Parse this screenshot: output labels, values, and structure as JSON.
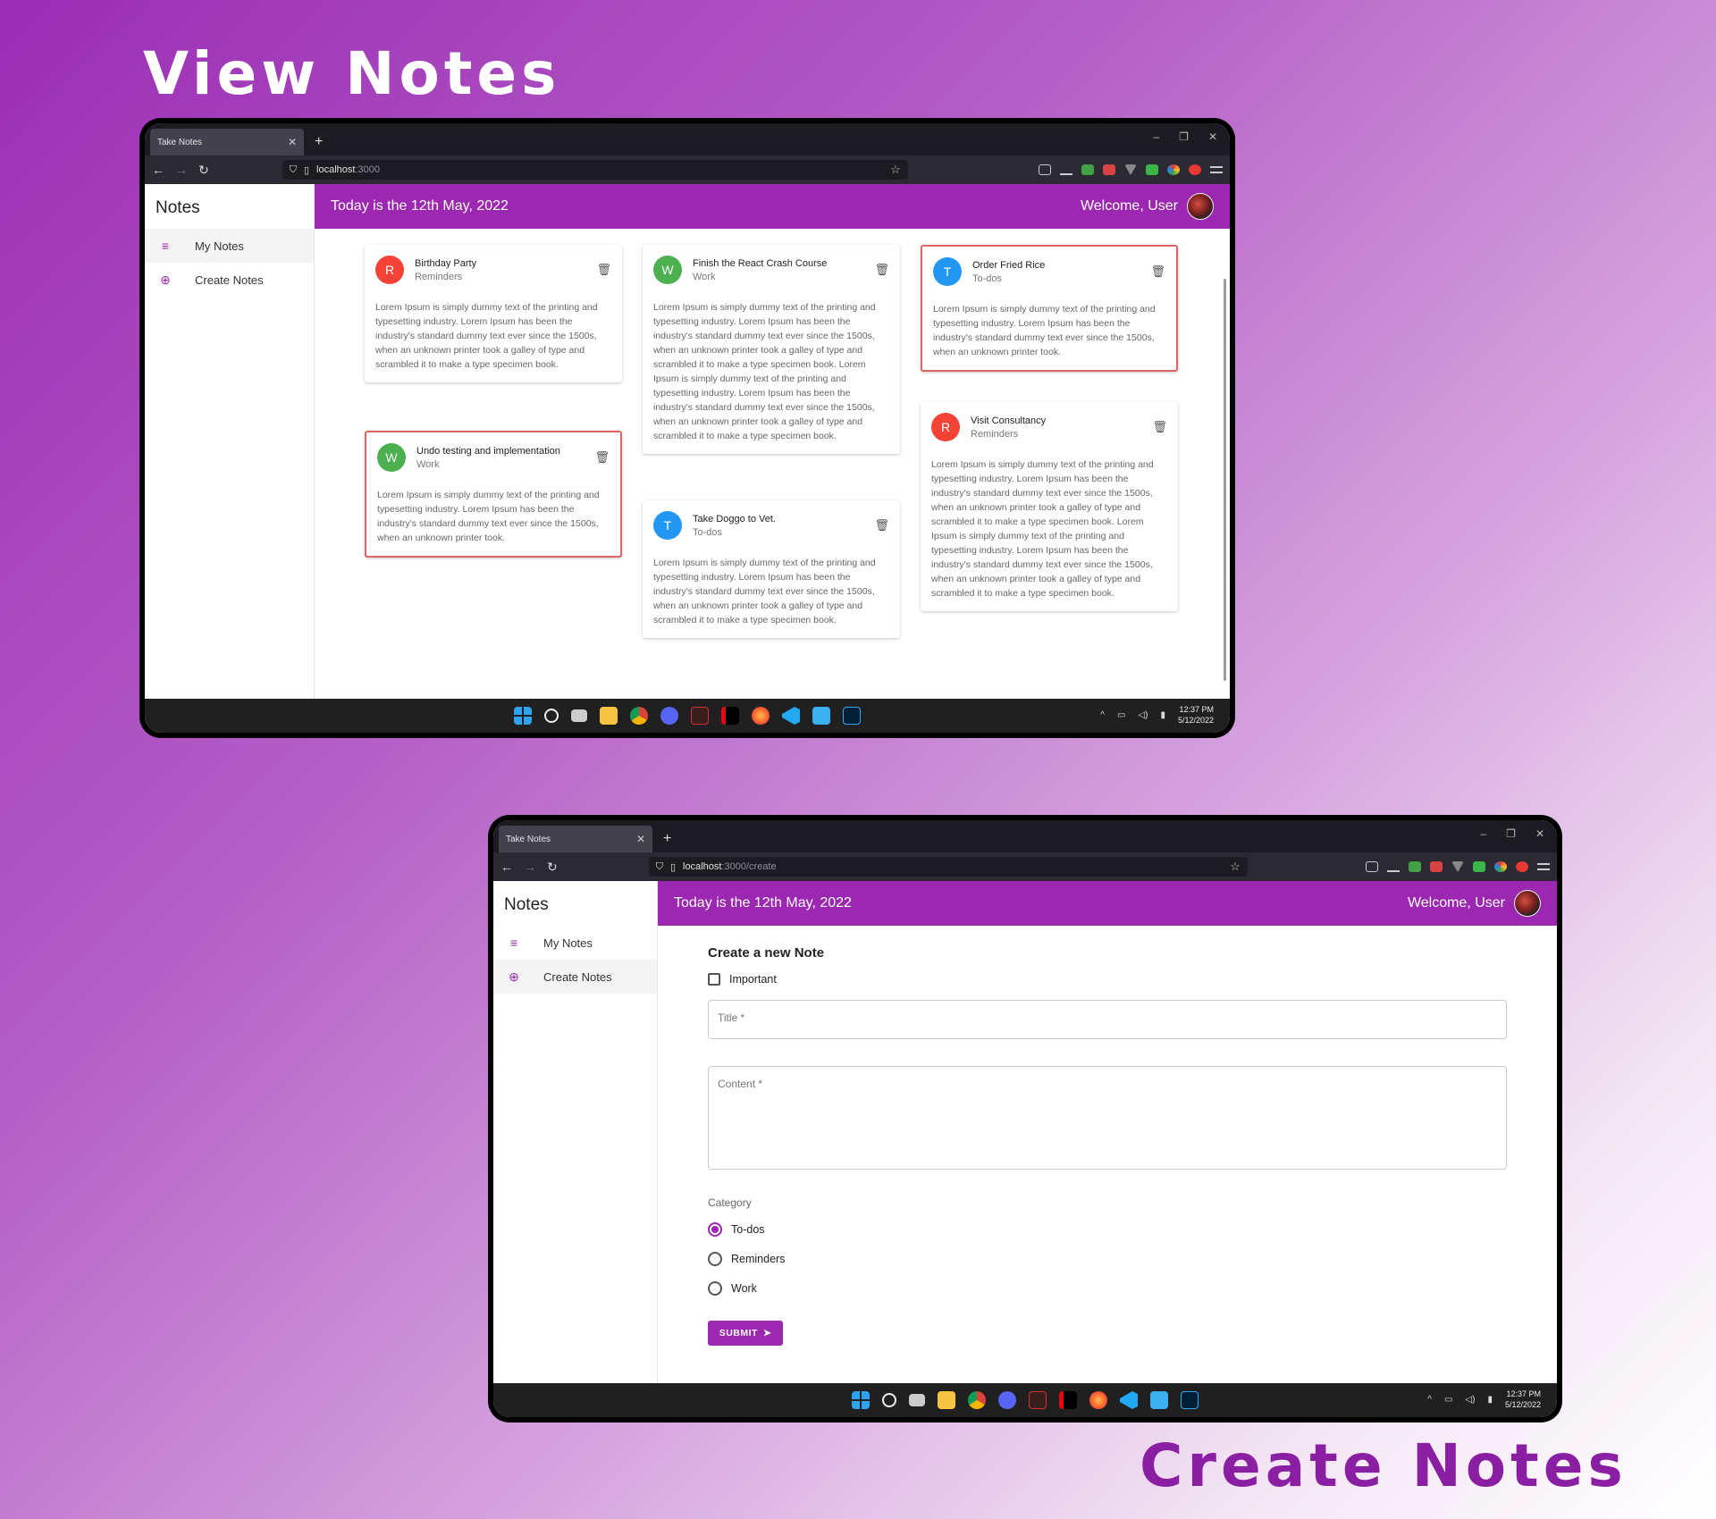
{
  "headings": {
    "view": "View Notes",
    "create": "Create Notes"
  },
  "browser": {
    "tab_title": "Take Notes",
    "url_host": "localhost",
    "url_path_view": ":3000",
    "url_path_create": ":3000/create"
  },
  "app": {
    "logo": "Notes",
    "date_text": "Today is the 12th May, 2022",
    "welcome": "Welcome, User",
    "menu": [
      {
        "label": "My Notes",
        "icon": "list-icon"
      },
      {
        "label": "Create Notes",
        "icon": "add-circle-icon"
      }
    ]
  },
  "notes": [
    {
      "title": "Birthday Party",
      "category": "Reminders",
      "initial": "R",
      "color": "#f44336",
      "important": false,
      "body": "Lorem Ipsum is simply dummy text of the printing and typesetting industry. Lorem Ipsum has been the industry's standard dummy text ever since the 1500s, when an unknown printer took a galley of type and scrambled it to make a type specimen book."
    },
    {
      "title": "Finish the React Crash Course",
      "category": "Work",
      "initial": "W",
      "color": "#4caf50",
      "important": false,
      "body": "Lorem Ipsum is simply dummy text of the printing and typesetting industry. Lorem Ipsum has been the industry's standard dummy text ever since the 1500s, when an unknown printer took a galley of type and scrambled it to make a type specimen book. Lorem Ipsum is simply dummy text of the printing and typesetting industry. Lorem Ipsum has been the industry's standard dummy text ever since the 1500s, when an unknown printer took a galley of type and scrambled it to make a type specimen book."
    },
    {
      "title": "Order Fried Rice",
      "category": "To-dos",
      "initial": "T",
      "color": "#2196f3",
      "important": true,
      "body": "Lorem Ipsum is simply dummy text of the printing and typesetting industry. Lorem Ipsum has been the industry's standard dummy text ever since the 1500s, when an unknown printer took."
    },
    {
      "title": "Undo testing and implementation",
      "category": "Work",
      "initial": "W",
      "color": "#4caf50",
      "important": true,
      "body": "Lorem Ipsum is simply dummy text of the printing and typesetting industry. Lorem Ipsum has been the industry's standard dummy text ever since the 1500s, when an unknown printer took."
    },
    {
      "title": "Take Doggo to Vet.",
      "category": "To-dos",
      "initial": "T",
      "color": "#2196f3",
      "important": false,
      "body": "Lorem Ipsum is simply dummy text of the printing and typesetting industry. Lorem Ipsum has been the industry's standard dummy text ever since the 1500s, when an unknown printer took a galley of type and scrambled it to make a type specimen book."
    },
    {
      "title": "Visit Consultancy",
      "category": "Reminders",
      "initial": "R",
      "color": "#f44336",
      "important": false,
      "body": "Lorem Ipsum is simply dummy text of the printing and typesetting industry. Lorem Ipsum has been the industry's standard dummy text ever since the 1500s, when an unknown printer took a galley of type and scrambled it to make a type specimen book. Lorem Ipsum is simply dummy text of the printing and typesetting industry. Lorem Ipsum has been the industry's standard dummy text ever since the 1500s, when an unknown printer took a galley of type and scrambled it to make a type specimen book."
    }
  ],
  "form": {
    "heading": "Create a new Note",
    "important_label": "Important",
    "title_placeholder": "Title *",
    "content_placeholder": "Content *",
    "category_label": "Category",
    "categories": [
      "To-dos",
      "Reminders",
      "Work"
    ],
    "selected_category": "To-dos",
    "submit_label": "SUBMIT"
  },
  "taskbar": {
    "time": "12:37 PM",
    "date": "5/12/2022",
    "apps": [
      "windows-icon",
      "search-icon",
      "task-view-icon",
      "file-explorer-icon",
      "chrome-icon",
      "discord-icon",
      "vivaldi-icon",
      "netflix-icon",
      "firefox-icon",
      "vscode-icon",
      "notepad-icon",
      "photoshop-icon"
    ]
  },
  "colors": {
    "accent": "#9c27b0",
    "important_border": "#e06464"
  }
}
